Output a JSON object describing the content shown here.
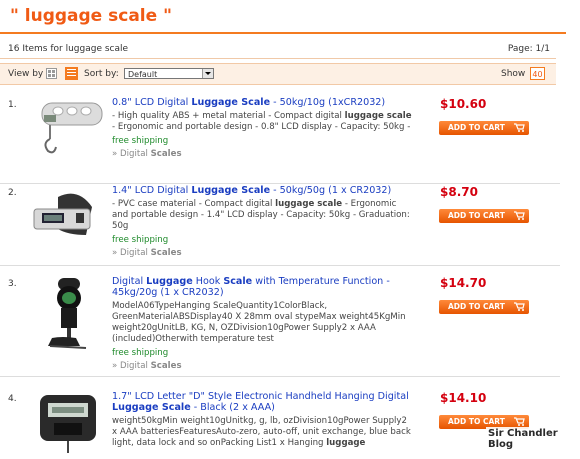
{
  "header": {
    "search_title": "\" luggage scale \""
  },
  "results": {
    "count_text": "16 Items for luggage scale",
    "page_text": "Page: 1/1"
  },
  "toolbar": {
    "view_label": "View by",
    "sort_label": "Sort by:",
    "sort_value": "Default",
    "show_label": "Show",
    "show_value": "40"
  },
  "items": [
    {
      "num": "1.",
      "title_pre": "0.8\" LCD Digital ",
      "title_bold": "Luggage Scale",
      "title_post": " - 50kg/10g (1xCR2032)",
      "desc_1": "- High quality ABS + metal material - Compact digital ",
      "desc_bold": "luggage scale",
      "desc_2": " - Ergonomic and portable design - 0.8\" LCD display - Capacity: 50kg -",
      "shipping": "free shipping",
      "category_pre": "» Digital ",
      "category_bold": "Scales",
      "price": "$10.60",
      "button": "ADD TO CART"
    },
    {
      "num": "2.",
      "title_pre": "1.4\" LCD Digital ",
      "title_bold": "Luggage Scale",
      "title_post": " - 50kg/50g (1 x CR2032)",
      "desc_1": "- PVC case material - Compact digital ",
      "desc_bold": "luggage scale",
      "desc_2": " - Ergonomic and portable design - 1.4\" LCD display - Capacity: 50kg - Graduation: 50g",
      "shipping": "free shipping",
      "category_pre": "» Digital ",
      "category_bold": "Scales",
      "price": "$8.70",
      "button": "ADD TO CART"
    },
    {
      "num": "3.",
      "title_pre": "Digital ",
      "title_bold": "Luggage",
      "title_mid": " Hook ",
      "title_bold2": "Scale",
      "title_post": " with Temperature Function - 45kg/20g (1 x CR2032)",
      "desc": "ModelA06TypeHanging ScaleQuantity1ColorBlack, GreenMaterialABSDisplay40 X 28mm oval stypeMax weight45KgMin weight20gUnitLB, KG, N, OZDivision10gPower Supply2 x AAA (included)Otherwith temperature test",
      "shipping": "free shipping",
      "category_pre": "» Digital ",
      "category_bold": "Scales",
      "price": "$14.70",
      "button": "ADD TO CART"
    },
    {
      "num": "4.",
      "title_pre": "1.7\" LCD Letter \"D\" Style Electronic Handheld Hanging Digital ",
      "title_bold": "Luggage Scale",
      "title_post": " - Black (2 x AAA)",
      "desc_1": "weight50kgMin weight10gUnitkg, g, lb, ozDivision10gPower Supply2 x AAA batteriesFeaturesAuto-zero, auto-off, unit exchange, blue back light, data lock and so onPacking List1 x Hanging ",
      "desc_bold": "luggage",
      "price": "$14.10",
      "button": "ADD TO CART"
    }
  ],
  "watermark": "Sir Chandler Blog",
  "colors": {
    "accent": "#f47b20",
    "price": "#d4000f",
    "link": "#1a3dc1",
    "shipping": "#1e8a2a"
  }
}
